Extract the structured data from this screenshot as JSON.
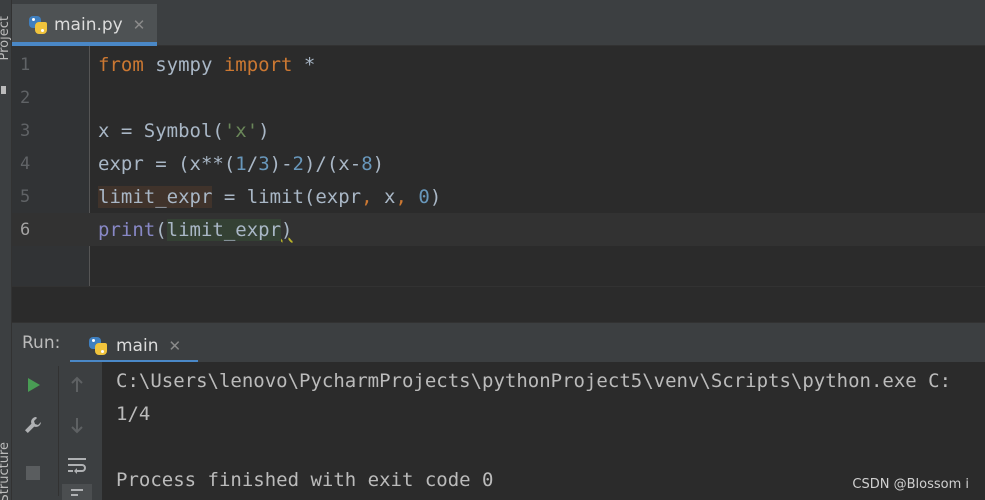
{
  "side_strip": {
    "top_label": "Project",
    "bottom_label": "Structure"
  },
  "editor_tab": {
    "label": "main.py",
    "close": "✕",
    "icon": "python-file-icon"
  },
  "code": {
    "line_numbers": [
      "1",
      "2",
      "3",
      "4",
      "5",
      "6"
    ],
    "current_line": 6
  },
  "run": {
    "title": "Run:",
    "tab_label": "main",
    "tab_close": "✕",
    "toolbar": [
      "run-icon",
      "wrench-icon",
      "stop-icon",
      "up-arrow-icon",
      "down-arrow-icon",
      "soft-wrap-icon",
      "scroll-to-end-icon"
    ],
    "output": [
      "C:\\Users\\lenovo\\PycharmProjects\\pythonProject5\\venv\\Scripts\\python.exe C:",
      "1/4",
      "",
      "Process finished with exit code 0"
    ]
  },
  "watermark": "CSDN @Blossom i",
  "colors": {
    "accent": "#4a88c7",
    "keyword": "#cc7832",
    "number": "#6897bb",
    "string": "#6a8759",
    "builtin": "#8888c6",
    "run_green": "#499c54"
  }
}
